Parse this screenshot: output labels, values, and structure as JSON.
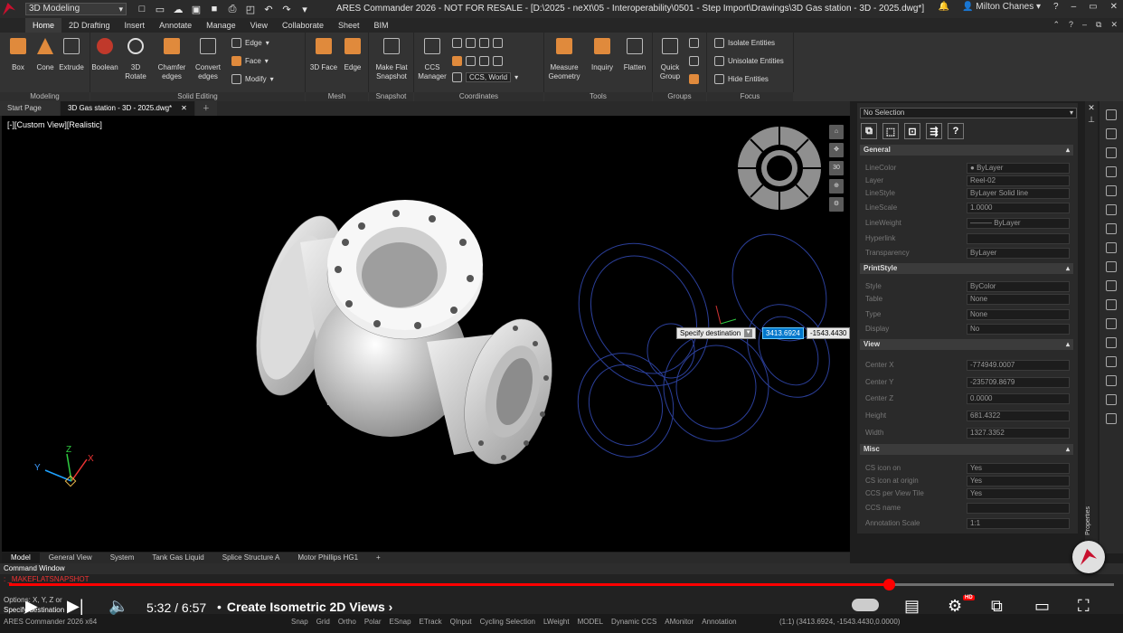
{
  "app": {
    "workspace": "3D Modeling",
    "title": "ARES Commander 2026 - NOT FOR RESALE - [D:\\2025 - neXt\\05 - Interoperability\\0501 - Step Import\\Drawings\\3D Gas station - 3D - 2025.dwg*]",
    "user": "Milton Chanes",
    "help": "?"
  },
  "ribbon_tabs": [
    "Home",
    "2D Drafting",
    "Insert",
    "Annotate",
    "Manage",
    "View",
    "Collaborate",
    "Sheet",
    "BIM"
  ],
  "ribbon": {
    "groups": {
      "modeling": "Modeling",
      "solid_editing": "Solid Editing",
      "mesh": "Mesh",
      "snapshot": "Snapshot",
      "coordinates": "Coordinates",
      "tools": "Tools",
      "groups": "Groups",
      "focus": "Focus"
    },
    "buttons": {
      "box": "Box",
      "cone": "Cone",
      "extrude": "Extrude",
      "boolean": "Boolean",
      "rotate3d": "3D Rotate",
      "chamfer": "Chamfer edges",
      "convert": "Convert edges",
      "edge": "Edge",
      "face": "Face",
      "modify": "Modify",
      "face3d": "3D Face",
      "mesh_edge": "Edge",
      "make_flat": "Make Flat Snapshot",
      "ccs_manager": "CCS Manager",
      "ccs_world": "CCS, World",
      "measure": "Measure Geometry",
      "inquiry": "Inquiry",
      "flatten": "Flatten",
      "quick_group": "Quick Group",
      "isolate": "Isolate Entities",
      "unisolate": "Unisolate Entities",
      "hide": "Hide Entities"
    }
  },
  "doc_tabs": [
    "Start Page",
    "3D Gas station - 3D - 2025.dwg*"
  ],
  "viewport": {
    "label": "[-][Custom View][Realistic]",
    "prompt": "Specify destination",
    "dyn_x": "3413.6924",
    "dyn_y": "-1543.4430",
    "nav_30": "30",
    "axis_x": "X",
    "axis_y": "Y",
    "axis_z": "Z"
  },
  "layout_tabs": [
    "Model",
    "General View",
    "System",
    "Tank Gas Liquid",
    "Splice Structure A",
    "Motor Phillips HG1",
    "+"
  ],
  "command": {
    "title": "Command Window",
    "line1": ": _MAKEFLATSNAPSHOT",
    "line2": "Options: X, Y, Z or",
    "line3": "Specify destination"
  },
  "properties": {
    "selection": "No Selection",
    "sections": {
      "general": "General",
      "printstyle": "PrintStyle",
      "view": "View",
      "misc": "Misc"
    },
    "general": [
      {
        "k": "LineColor",
        "v": "ByLayer"
      },
      {
        "k": "Layer",
        "v": "Reel-02"
      },
      {
        "k": "LineStyle",
        "v": "ByLayer      Solid line"
      },
      {
        "k": "LineScale",
        "v": "1.0000"
      },
      {
        "k": "LineWeight",
        "v": "——— ByLayer"
      },
      {
        "k": "Hyperlink",
        "v": ""
      },
      {
        "k": "Transparency",
        "v": "ByLayer"
      }
    ],
    "printstyle": [
      {
        "k": "Style",
        "v": "ByColor"
      },
      {
        "k": "Table",
        "v": "None"
      },
      {
        "k": "Type",
        "v": "None"
      },
      {
        "k": "Display",
        "v": "No"
      }
    ],
    "view": [
      {
        "k": "Center X",
        "v": "-774949.0007"
      },
      {
        "k": "Center Y",
        "v": "-235709.8679"
      },
      {
        "k": "Center Z",
        "v": "0.0000"
      },
      {
        "k": "Height",
        "v": "681.4322"
      },
      {
        "k": "Width",
        "v": "1327.3352"
      }
    ],
    "misc": [
      {
        "k": "CS icon on",
        "v": "Yes"
      },
      {
        "k": "CS icon at origin",
        "v": "Yes"
      },
      {
        "k": "CCS per View Tile",
        "v": "Yes"
      },
      {
        "k": "CCS name",
        "v": ""
      },
      {
        "k": "Annotation Scale",
        "v": "1:1"
      }
    ],
    "vertical_label": "Properties"
  },
  "statusbar": {
    "version": "ARES Commander 2026 x64",
    "items": [
      "Snap",
      "Grid",
      "Ortho",
      "Polar",
      "ESnap",
      "ETrack",
      "QInput",
      "Cycling Selection",
      "LWeight",
      "MODEL",
      "Dynamic CCS",
      "AMonitor",
      "Annotation"
    ],
    "coords": "(1:1)  (3413.6924, -1543.4430,0.0000)"
  },
  "video": {
    "time": "5:32 / 6:57",
    "chapter": "Create Isometric 2D Views",
    "progress": 0.796,
    "hd": "HD"
  },
  "colors": {
    "accent": "#c8102e",
    "progress": "#ff0000",
    "dyn_input": "#0077cc"
  }
}
